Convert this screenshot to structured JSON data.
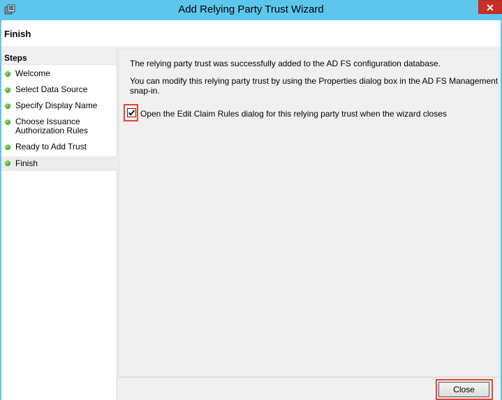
{
  "window": {
    "title": "Add Relying Party Trust Wizard",
    "close_glyph": "✕"
  },
  "header": {
    "page_title": "Finish"
  },
  "sidebar": {
    "heading": "Steps",
    "items": [
      {
        "label": "Welcome"
      },
      {
        "label": "Select Data Source"
      },
      {
        "label": "Specify Display Name"
      },
      {
        "label": "Choose Issuance Authorization Rules"
      },
      {
        "label": "Ready to Add Trust"
      },
      {
        "label": "Finish"
      }
    ],
    "status_color": "#3ea21a"
  },
  "main": {
    "message1": "The relying party trust was successfully added to the AD FS configuration database.",
    "message2": "You can modify this relying party trust by using the Properties dialog box in the AD FS Management snap-in.",
    "checkbox": {
      "checked": true,
      "label": "Open the Edit Claim Rules dialog for this relying party trust when the wizard closes"
    }
  },
  "footer": {
    "close_label": "Close"
  },
  "colors": {
    "titlebar": "#5ec6ec",
    "highlight": "#e8452c"
  }
}
